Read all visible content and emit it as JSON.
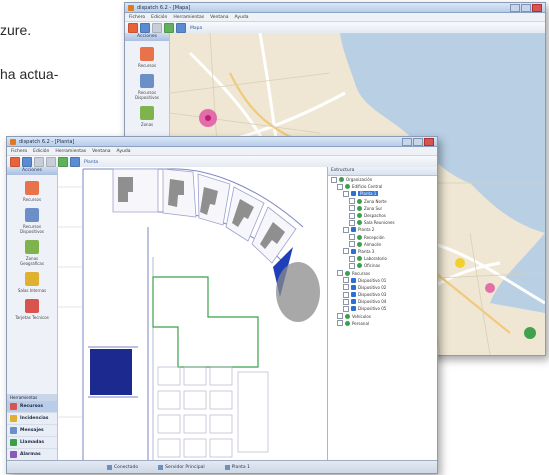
{
  "background_text": {
    "line1": "zure.",
    "line2": "ha actua-"
  },
  "back_window": {
    "title": "dispatch 6.2 - [Mapa]",
    "menu": [
      "Fichero",
      "Edición",
      "Herramientas",
      "Ventana",
      "Ayuda"
    ],
    "toolbar_label": "Mapa",
    "sidebar_header": "Acciones",
    "sidebar_buttons": [
      {
        "label": "Recursos",
        "color": "#e8734a"
      },
      {
        "label": "Recursos Dispositivos",
        "color": "#6c8fc8"
      },
      {
        "label": "Zonas",
        "color": "#7fb34d"
      }
    ]
  },
  "front_window": {
    "title": "dispatch 6.2 - [Planta]",
    "menu": [
      "Fichero",
      "Edición",
      "Herramientas",
      "Ventana",
      "Ayuda"
    ],
    "toolbar_label": "Planta",
    "sidebar_header": "Acciones",
    "sidebar_buttons": [
      {
        "label": "Recursos",
        "color": "#e8734a"
      },
      {
        "label": "Recursos Dispositivos",
        "color": "#6c8fc8"
      },
      {
        "label": "Zonas Geograficas",
        "color": "#7fb34d"
      },
      {
        "label": "Salas Internas",
        "color": "#e0b030"
      },
      {
        "label": "Tarjetas Tecnicos",
        "color": "#d9534f"
      }
    ],
    "nav_header": "Herramientas",
    "nav_items": [
      {
        "label": "Recursos",
        "color": "#d9534f",
        "selected": true
      },
      {
        "label": "Incidencias",
        "color": "#e0b030",
        "selected": false
      },
      {
        "label": "Mensajes",
        "color": "#6c8fc8",
        "selected": false
      },
      {
        "label": "Llamadas",
        "color": "#3ca04a",
        "selected": false
      },
      {
        "label": "Alarmas",
        "color": "#8a5ab8",
        "selected": false
      }
    ],
    "tree_header": "Estructura",
    "tree_rows": [
      {
        "label": "Organización",
        "indent": 0,
        "type": "node",
        "selected": false
      },
      {
        "label": "Edificio Central",
        "indent": 1,
        "type": "node",
        "selected": false
      },
      {
        "label": "Planta 1",
        "indent": 2,
        "type": "sq",
        "selected": true
      },
      {
        "label": "Zona Norte",
        "indent": 3,
        "type": "node",
        "selected": false
      },
      {
        "label": "Zona Sur",
        "indent": 3,
        "type": "node",
        "selected": false
      },
      {
        "label": "Despachos",
        "indent": 3,
        "type": "node",
        "selected": false
      },
      {
        "label": "Sala Reuniones",
        "indent": 3,
        "type": "node",
        "selected": false
      },
      {
        "label": "Planta 2",
        "indent": 2,
        "type": "sq",
        "selected": false
      },
      {
        "label": "Recepción",
        "indent": 3,
        "type": "node",
        "selected": false
      },
      {
        "label": "Almacén",
        "indent": 3,
        "type": "node",
        "selected": false
      },
      {
        "label": "Planta 3",
        "indent": 2,
        "type": "sq",
        "selected": false
      },
      {
        "label": "Laboratorio",
        "indent": 3,
        "type": "node",
        "selected": false
      },
      {
        "label": "Oficinas",
        "indent": 3,
        "type": "node",
        "selected": false
      },
      {
        "label": "Recursos",
        "indent": 1,
        "type": "node",
        "selected": false
      },
      {
        "label": "Dispositivo 01",
        "indent": 2,
        "type": "sq",
        "selected": false
      },
      {
        "label": "Dispositivo 02",
        "indent": 2,
        "type": "sq",
        "selected": false
      },
      {
        "label": "Dispositivo 03",
        "indent": 2,
        "type": "sq",
        "selected": false
      },
      {
        "label": "Dispositivo 04",
        "indent": 2,
        "type": "sq",
        "selected": false
      },
      {
        "label": "Dispositivo 05",
        "indent": 2,
        "type": "sq",
        "selected": false
      },
      {
        "label": "Vehículos",
        "indent": 1,
        "type": "node",
        "selected": false
      },
      {
        "label": "Personal",
        "indent": 1,
        "type": "node",
        "selected": false
      }
    ],
    "status_cells": [
      "Conectado",
      "Servidor Principal",
      "Planta 1"
    ]
  }
}
